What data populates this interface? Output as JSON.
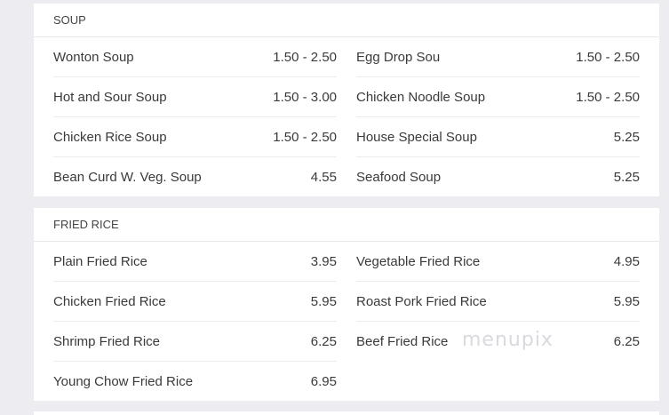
{
  "sections": [
    {
      "title": "SOUP",
      "left": [
        {
          "name": "Wonton Soup",
          "price": "1.50 - 2.50"
        },
        {
          "name": "Hot and Sour Soup",
          "price": "1.50 - 3.00"
        },
        {
          "name": "Chicken Rice Soup",
          "price": "1.50 - 2.50"
        },
        {
          "name": "Bean Curd W. Veg. Soup",
          "price": "4.55"
        }
      ],
      "right": [
        {
          "name": "Egg Drop Sou",
          "price": "1.50 - 2.50"
        },
        {
          "name": "Chicken Noodle Soup",
          "price": "1.50 - 2.50"
        },
        {
          "name": "House Special Soup",
          "price": "5.25"
        },
        {
          "name": "Seafood Soup",
          "price": "5.25"
        }
      ]
    },
    {
      "title": "FRIED RICE",
      "left": [
        {
          "name": "Plain Fried Rice",
          "price": "3.95"
        },
        {
          "name": "Chicken Fried Rice",
          "price": "5.95"
        },
        {
          "name": "Shrimp Fried Rice",
          "price": "6.25"
        },
        {
          "name": "Young Chow Fried Rice",
          "price": "6.95"
        }
      ],
      "right": [
        {
          "name": "Vegetable Fried Rice",
          "price": "4.95"
        },
        {
          "name": "Roast Pork Fried Rice",
          "price": "5.95"
        },
        {
          "name": "Beef Fried Rice",
          "price": "6.25"
        }
      ]
    }
  ],
  "watermark": "menupix"
}
